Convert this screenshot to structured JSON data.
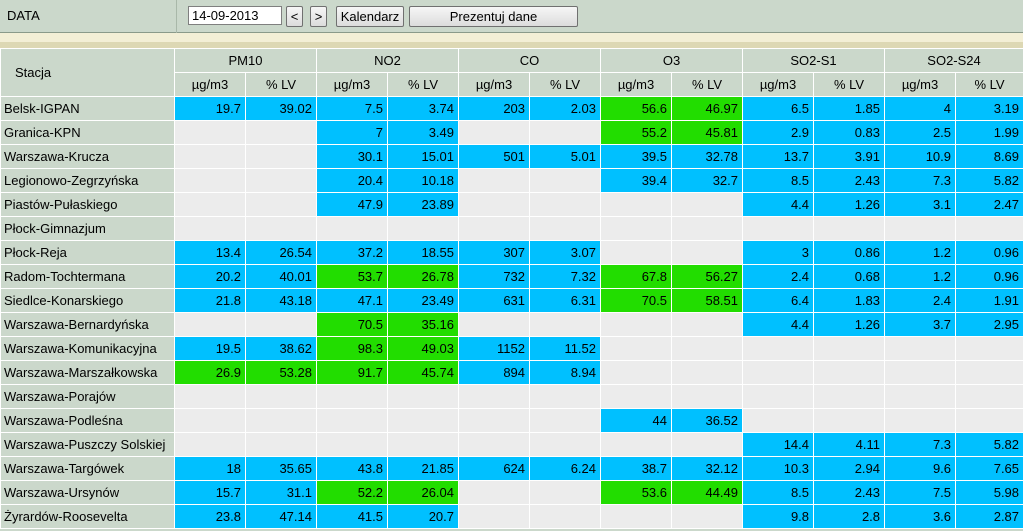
{
  "toolbar": {
    "date_label": "DATA",
    "date_value": "14-09-2013",
    "prev_label": "<",
    "next_label": ">",
    "calendar_label": "Kalendarz",
    "show_label": "Prezentuj dane"
  },
  "colors": {
    "blue": "#00c0ff",
    "green": "#22dd00",
    "empty": "#ececec",
    "header": "#cbd8cb"
  },
  "table": {
    "station_header": "Stacja",
    "groups": [
      "PM10",
      "NO2",
      "CO",
      "O3",
      "SO2-S1",
      "SO2-S24"
    ],
    "subheaders": [
      "µg/m3",
      "% LV"
    ],
    "rows": [
      {
        "name": "Belsk-IGPAN",
        "cells": [
          [
            "19.7",
            "blue"
          ],
          [
            "39.02",
            "blue"
          ],
          [
            "7.5",
            "blue"
          ],
          [
            "3.74",
            "blue"
          ],
          [
            "203",
            "blue"
          ],
          [
            "2.03",
            "blue"
          ],
          [
            "56.6",
            "green"
          ],
          [
            "46.97",
            "green"
          ],
          [
            "6.5",
            "blue"
          ],
          [
            "1.85",
            "blue"
          ],
          [
            "4",
            "blue"
          ],
          [
            "3.19",
            "blue"
          ]
        ]
      },
      {
        "name": "Granica-KPN",
        "cells": [
          [
            "",
            "empty"
          ],
          [
            "",
            "empty"
          ],
          [
            "7",
            "blue"
          ],
          [
            "3.49",
            "blue"
          ],
          [
            "",
            "empty"
          ],
          [
            "",
            "empty"
          ],
          [
            "55.2",
            "green"
          ],
          [
            "45.81",
            "green"
          ],
          [
            "2.9",
            "blue"
          ],
          [
            "0.83",
            "blue"
          ],
          [
            "2.5",
            "blue"
          ],
          [
            "1.99",
            "blue"
          ]
        ]
      },
      {
        "name": "Warszawa-Krucza",
        "cells": [
          [
            "",
            "empty"
          ],
          [
            "",
            "empty"
          ],
          [
            "30.1",
            "blue"
          ],
          [
            "15.01",
            "blue"
          ],
          [
            "501",
            "blue"
          ],
          [
            "5.01",
            "blue"
          ],
          [
            "39.5",
            "blue"
          ],
          [
            "32.78",
            "blue"
          ],
          [
            "13.7",
            "blue"
          ],
          [
            "3.91",
            "blue"
          ],
          [
            "10.9",
            "blue"
          ],
          [
            "8.69",
            "blue"
          ]
        ]
      },
      {
        "name": "Legionowo-Zegrzyńska",
        "cells": [
          [
            "",
            "empty"
          ],
          [
            "",
            "empty"
          ],
          [
            "20.4",
            "blue"
          ],
          [
            "10.18",
            "blue"
          ],
          [
            "",
            "empty"
          ],
          [
            "",
            "empty"
          ],
          [
            "39.4",
            "blue"
          ],
          [
            "32.7",
            "blue"
          ],
          [
            "8.5",
            "blue"
          ],
          [
            "2.43",
            "blue"
          ],
          [
            "7.3",
            "blue"
          ],
          [
            "5.82",
            "blue"
          ]
        ]
      },
      {
        "name": "Piastów-Pułaskiego",
        "cells": [
          [
            "",
            "empty"
          ],
          [
            "",
            "empty"
          ],
          [
            "47.9",
            "blue"
          ],
          [
            "23.89",
            "blue"
          ],
          [
            "",
            "empty"
          ],
          [
            "",
            "empty"
          ],
          [
            "",
            "empty"
          ],
          [
            "",
            "empty"
          ],
          [
            "4.4",
            "blue"
          ],
          [
            "1.26",
            "blue"
          ],
          [
            "3.1",
            "blue"
          ],
          [
            "2.47",
            "blue"
          ]
        ]
      },
      {
        "name": "Płock-Gimnazjum",
        "cells": [
          [
            "",
            "empty"
          ],
          [
            "",
            "empty"
          ],
          [
            "",
            "empty"
          ],
          [
            "",
            "empty"
          ],
          [
            "",
            "empty"
          ],
          [
            "",
            "empty"
          ],
          [
            "",
            "empty"
          ],
          [
            "",
            "empty"
          ],
          [
            "",
            "empty"
          ],
          [
            "",
            "empty"
          ],
          [
            "",
            "empty"
          ],
          [
            "",
            "empty"
          ]
        ]
      },
      {
        "name": "Płock-Reja",
        "cells": [
          [
            "13.4",
            "blue"
          ],
          [
            "26.54",
            "blue"
          ],
          [
            "37.2",
            "blue"
          ],
          [
            "18.55",
            "blue"
          ],
          [
            "307",
            "blue"
          ],
          [
            "3.07",
            "blue"
          ],
          [
            "",
            "empty"
          ],
          [
            "",
            "empty"
          ],
          [
            "3",
            "blue"
          ],
          [
            "0.86",
            "blue"
          ],
          [
            "1.2",
            "blue"
          ],
          [
            "0.96",
            "blue"
          ]
        ]
      },
      {
        "name": "Radom-Tochtermana",
        "cells": [
          [
            "20.2",
            "blue"
          ],
          [
            "40.01",
            "blue"
          ],
          [
            "53.7",
            "green"
          ],
          [
            "26.78",
            "green"
          ],
          [
            "732",
            "blue"
          ],
          [
            "7.32",
            "blue"
          ],
          [
            "67.8",
            "green"
          ],
          [
            "56.27",
            "green"
          ],
          [
            "2.4",
            "blue"
          ],
          [
            "0.68",
            "blue"
          ],
          [
            "1.2",
            "blue"
          ],
          [
            "0.96",
            "blue"
          ]
        ]
      },
      {
        "name": "Siedlce-Konarskiego",
        "cells": [
          [
            "21.8",
            "blue"
          ],
          [
            "43.18",
            "blue"
          ],
          [
            "47.1",
            "blue"
          ],
          [
            "23.49",
            "blue"
          ],
          [
            "631",
            "blue"
          ],
          [
            "6.31",
            "blue"
          ],
          [
            "70.5",
            "green"
          ],
          [
            "58.51",
            "green"
          ],
          [
            "6.4",
            "blue"
          ],
          [
            "1.83",
            "blue"
          ],
          [
            "2.4",
            "blue"
          ],
          [
            "1.91",
            "blue"
          ]
        ]
      },
      {
        "name": "Warszawa-Bernardyńska",
        "cells": [
          [
            "",
            "empty"
          ],
          [
            "",
            "empty"
          ],
          [
            "70.5",
            "green"
          ],
          [
            "35.16",
            "green"
          ],
          [
            "",
            "empty"
          ],
          [
            "",
            "empty"
          ],
          [
            "",
            "empty"
          ],
          [
            "",
            "empty"
          ],
          [
            "4.4",
            "blue"
          ],
          [
            "1.26",
            "blue"
          ],
          [
            "3.7",
            "blue"
          ],
          [
            "2.95",
            "blue"
          ]
        ]
      },
      {
        "name": "Warszawa-Komunikacyjna",
        "cells": [
          [
            "19.5",
            "blue"
          ],
          [
            "38.62",
            "blue"
          ],
          [
            "98.3",
            "green"
          ],
          [
            "49.03",
            "green"
          ],
          [
            "1152",
            "blue"
          ],
          [
            "11.52",
            "blue"
          ],
          [
            "",
            "empty"
          ],
          [
            "",
            "empty"
          ],
          [
            "",
            "empty"
          ],
          [
            "",
            "empty"
          ],
          [
            "",
            "empty"
          ],
          [
            "",
            "empty"
          ]
        ]
      },
      {
        "name": "Warszawa-Marszałkowska",
        "cells": [
          [
            "26.9",
            "green"
          ],
          [
            "53.28",
            "green"
          ],
          [
            "91.7",
            "green"
          ],
          [
            "45.74",
            "green"
          ],
          [
            "894",
            "blue"
          ],
          [
            "8.94",
            "blue"
          ],
          [
            "",
            "empty"
          ],
          [
            "",
            "empty"
          ],
          [
            "",
            "empty"
          ],
          [
            "",
            "empty"
          ],
          [
            "",
            "empty"
          ],
          [
            "",
            "empty"
          ]
        ]
      },
      {
        "name": "Warszawa-Porajów",
        "cells": [
          [
            "",
            "empty"
          ],
          [
            "",
            "empty"
          ],
          [
            "",
            "empty"
          ],
          [
            "",
            "empty"
          ],
          [
            "",
            "empty"
          ],
          [
            "",
            "empty"
          ],
          [
            "",
            "empty"
          ],
          [
            "",
            "empty"
          ],
          [
            "",
            "empty"
          ],
          [
            "",
            "empty"
          ],
          [
            "",
            "empty"
          ],
          [
            "",
            "empty"
          ]
        ]
      },
      {
        "name": "Warszawa-Podleśna",
        "cells": [
          [
            "",
            "empty"
          ],
          [
            "",
            "empty"
          ],
          [
            "",
            "empty"
          ],
          [
            "",
            "empty"
          ],
          [
            "",
            "empty"
          ],
          [
            "",
            "empty"
          ],
          [
            "44",
            "blue"
          ],
          [
            "36.52",
            "blue"
          ],
          [
            "",
            "empty"
          ],
          [
            "",
            "empty"
          ],
          [
            "",
            "empty"
          ],
          [
            "",
            "empty"
          ]
        ]
      },
      {
        "name": "Warszawa-Puszczy Solskiej",
        "cells": [
          [
            "",
            "empty"
          ],
          [
            "",
            "empty"
          ],
          [
            "",
            "empty"
          ],
          [
            "",
            "empty"
          ],
          [
            "",
            "empty"
          ],
          [
            "",
            "empty"
          ],
          [
            "",
            "empty"
          ],
          [
            "",
            "empty"
          ],
          [
            "14.4",
            "blue"
          ],
          [
            "4.11",
            "blue"
          ],
          [
            "7.3",
            "blue"
          ],
          [
            "5.82",
            "blue"
          ]
        ]
      },
      {
        "name": "Warszawa-Targówek",
        "cells": [
          [
            "18",
            "blue"
          ],
          [
            "35.65",
            "blue"
          ],
          [
            "43.8",
            "blue"
          ],
          [
            "21.85",
            "blue"
          ],
          [
            "624",
            "blue"
          ],
          [
            "6.24",
            "blue"
          ],
          [
            "38.7",
            "blue"
          ],
          [
            "32.12",
            "blue"
          ],
          [
            "10.3",
            "blue"
          ],
          [
            "2.94",
            "blue"
          ],
          [
            "9.6",
            "blue"
          ],
          [
            "7.65",
            "blue"
          ]
        ]
      },
      {
        "name": "Warszawa-Ursynów",
        "cells": [
          [
            "15.7",
            "blue"
          ],
          [
            "31.1",
            "blue"
          ],
          [
            "52.2",
            "green"
          ],
          [
            "26.04",
            "green"
          ],
          [
            "",
            "empty"
          ],
          [
            "",
            "empty"
          ],
          [
            "53.6",
            "green"
          ],
          [
            "44.49",
            "green"
          ],
          [
            "8.5",
            "blue"
          ],
          [
            "2.43",
            "blue"
          ],
          [
            "7.5",
            "blue"
          ],
          [
            "5.98",
            "blue"
          ]
        ]
      },
      {
        "name": "Żyrardów-Roosevelta",
        "cells": [
          [
            "23.8",
            "blue"
          ],
          [
            "47.14",
            "blue"
          ],
          [
            "41.5",
            "blue"
          ],
          [
            "20.7",
            "blue"
          ],
          [
            "",
            "empty"
          ],
          [
            "",
            "empty"
          ],
          [
            "",
            "empty"
          ],
          [
            "",
            "empty"
          ],
          [
            "9.8",
            "blue"
          ],
          [
            "2.8",
            "blue"
          ],
          [
            "3.6",
            "blue"
          ],
          [
            "2.87",
            "blue"
          ]
        ]
      }
    ]
  }
}
